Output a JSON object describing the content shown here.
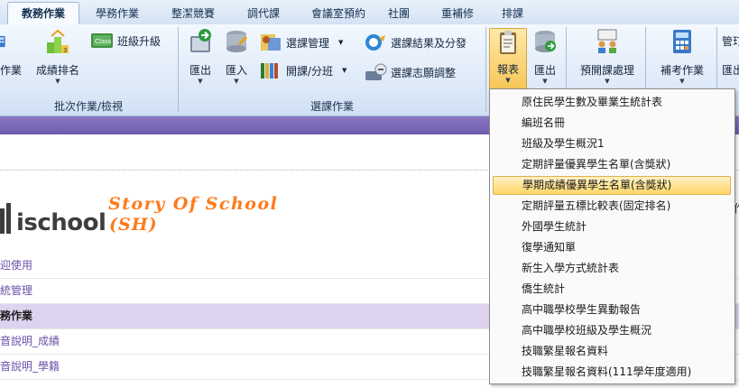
{
  "tabs": [
    {
      "label": "教務作業",
      "active": true
    },
    {
      "label": "學務作業",
      "active": false
    },
    {
      "label": "整潔競賽",
      "active": false
    },
    {
      "label": "調代課",
      "active": false
    },
    {
      "label": "會議室預約",
      "active": false
    },
    {
      "label": "社團",
      "active": false
    },
    {
      "label": "重補修",
      "active": false
    },
    {
      "label": "排課",
      "active": false
    }
  ],
  "ribbon": {
    "batch_group": {
      "label": "批次作業/檢視",
      "homework_cut": "作業",
      "rank": "成績排名",
      "promote": "班級升級"
    },
    "course_group": {
      "label": "選課作業",
      "export": "匯出",
      "import": "匯入",
      "course_mgmt": "選課管理",
      "open_course": "開課/分班",
      "result_assign": "選課結果及分發",
      "wish_adjust": "選課志願調整"
    },
    "report_group": {
      "report": "報表",
      "export": "匯出",
      "preopen": "預開課處理",
      "makeup_exam": "補考作業",
      "cut_manage": "管玎",
      "cut_export": "匯出"
    }
  },
  "brand": {
    "logo": "ischool",
    "tagline1": "Story Of School",
    "tagline2": "(SH)"
  },
  "nav": [
    {
      "label": "迎使用",
      "active": false
    },
    {
      "label": "統管理",
      "active": false
    },
    {
      "label": "務作業",
      "active": true
    },
    {
      "label": "音說明_成績",
      "active": false
    },
    {
      "label": "音說明_學籍",
      "active": false
    }
  ],
  "report_menu": [
    "原住民學生數及畢業生統計表",
    "編班名冊",
    "班級及學生概況1",
    "定期評量優異學生名單(含獎狀)",
    "學期成績優異學生名單(含獎狀)",
    "定期評量五標比較表(固定排名)",
    "外國學生統計",
    "復學通知單",
    "新生入學方式統計表",
    "僑生統計",
    "高中職學校學生異動報告",
    "高中職學校班級及學生概況",
    "技職繁星報名資料",
    "技職繁星報名資料(111學年度適用)"
  ],
  "highlighted_index": 4,
  "right_cut_text": "作",
  "colors": {
    "accent_purple": "#6f5cae",
    "brand_orange": "#ff7a1a",
    "highlight": "#ffd666"
  }
}
